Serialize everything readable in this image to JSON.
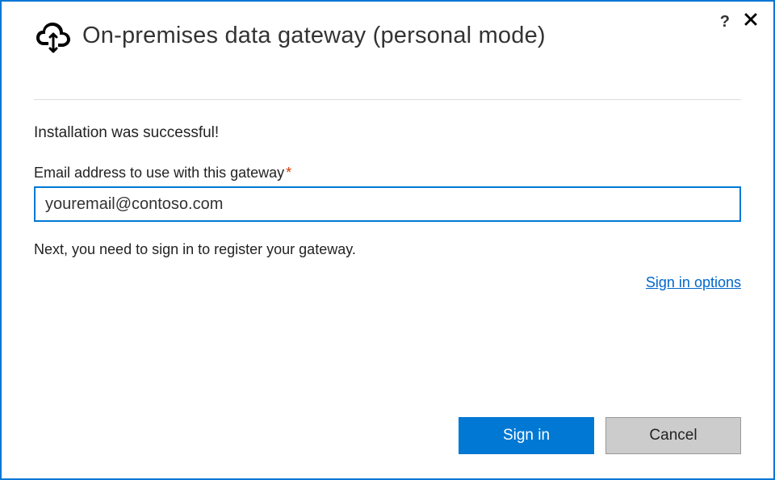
{
  "header": {
    "title": "On-premises data gateway (personal mode)"
  },
  "body": {
    "status": "Installation was successful!",
    "email_label": "Email address to use with this gateway",
    "required_marker": "*",
    "email_value": "youremail@contoso.com",
    "instruction": "Next, you need to sign in to register your gateway.",
    "sign_in_options": "Sign in options"
  },
  "buttons": {
    "sign_in": "Sign in",
    "cancel": "Cancel"
  }
}
